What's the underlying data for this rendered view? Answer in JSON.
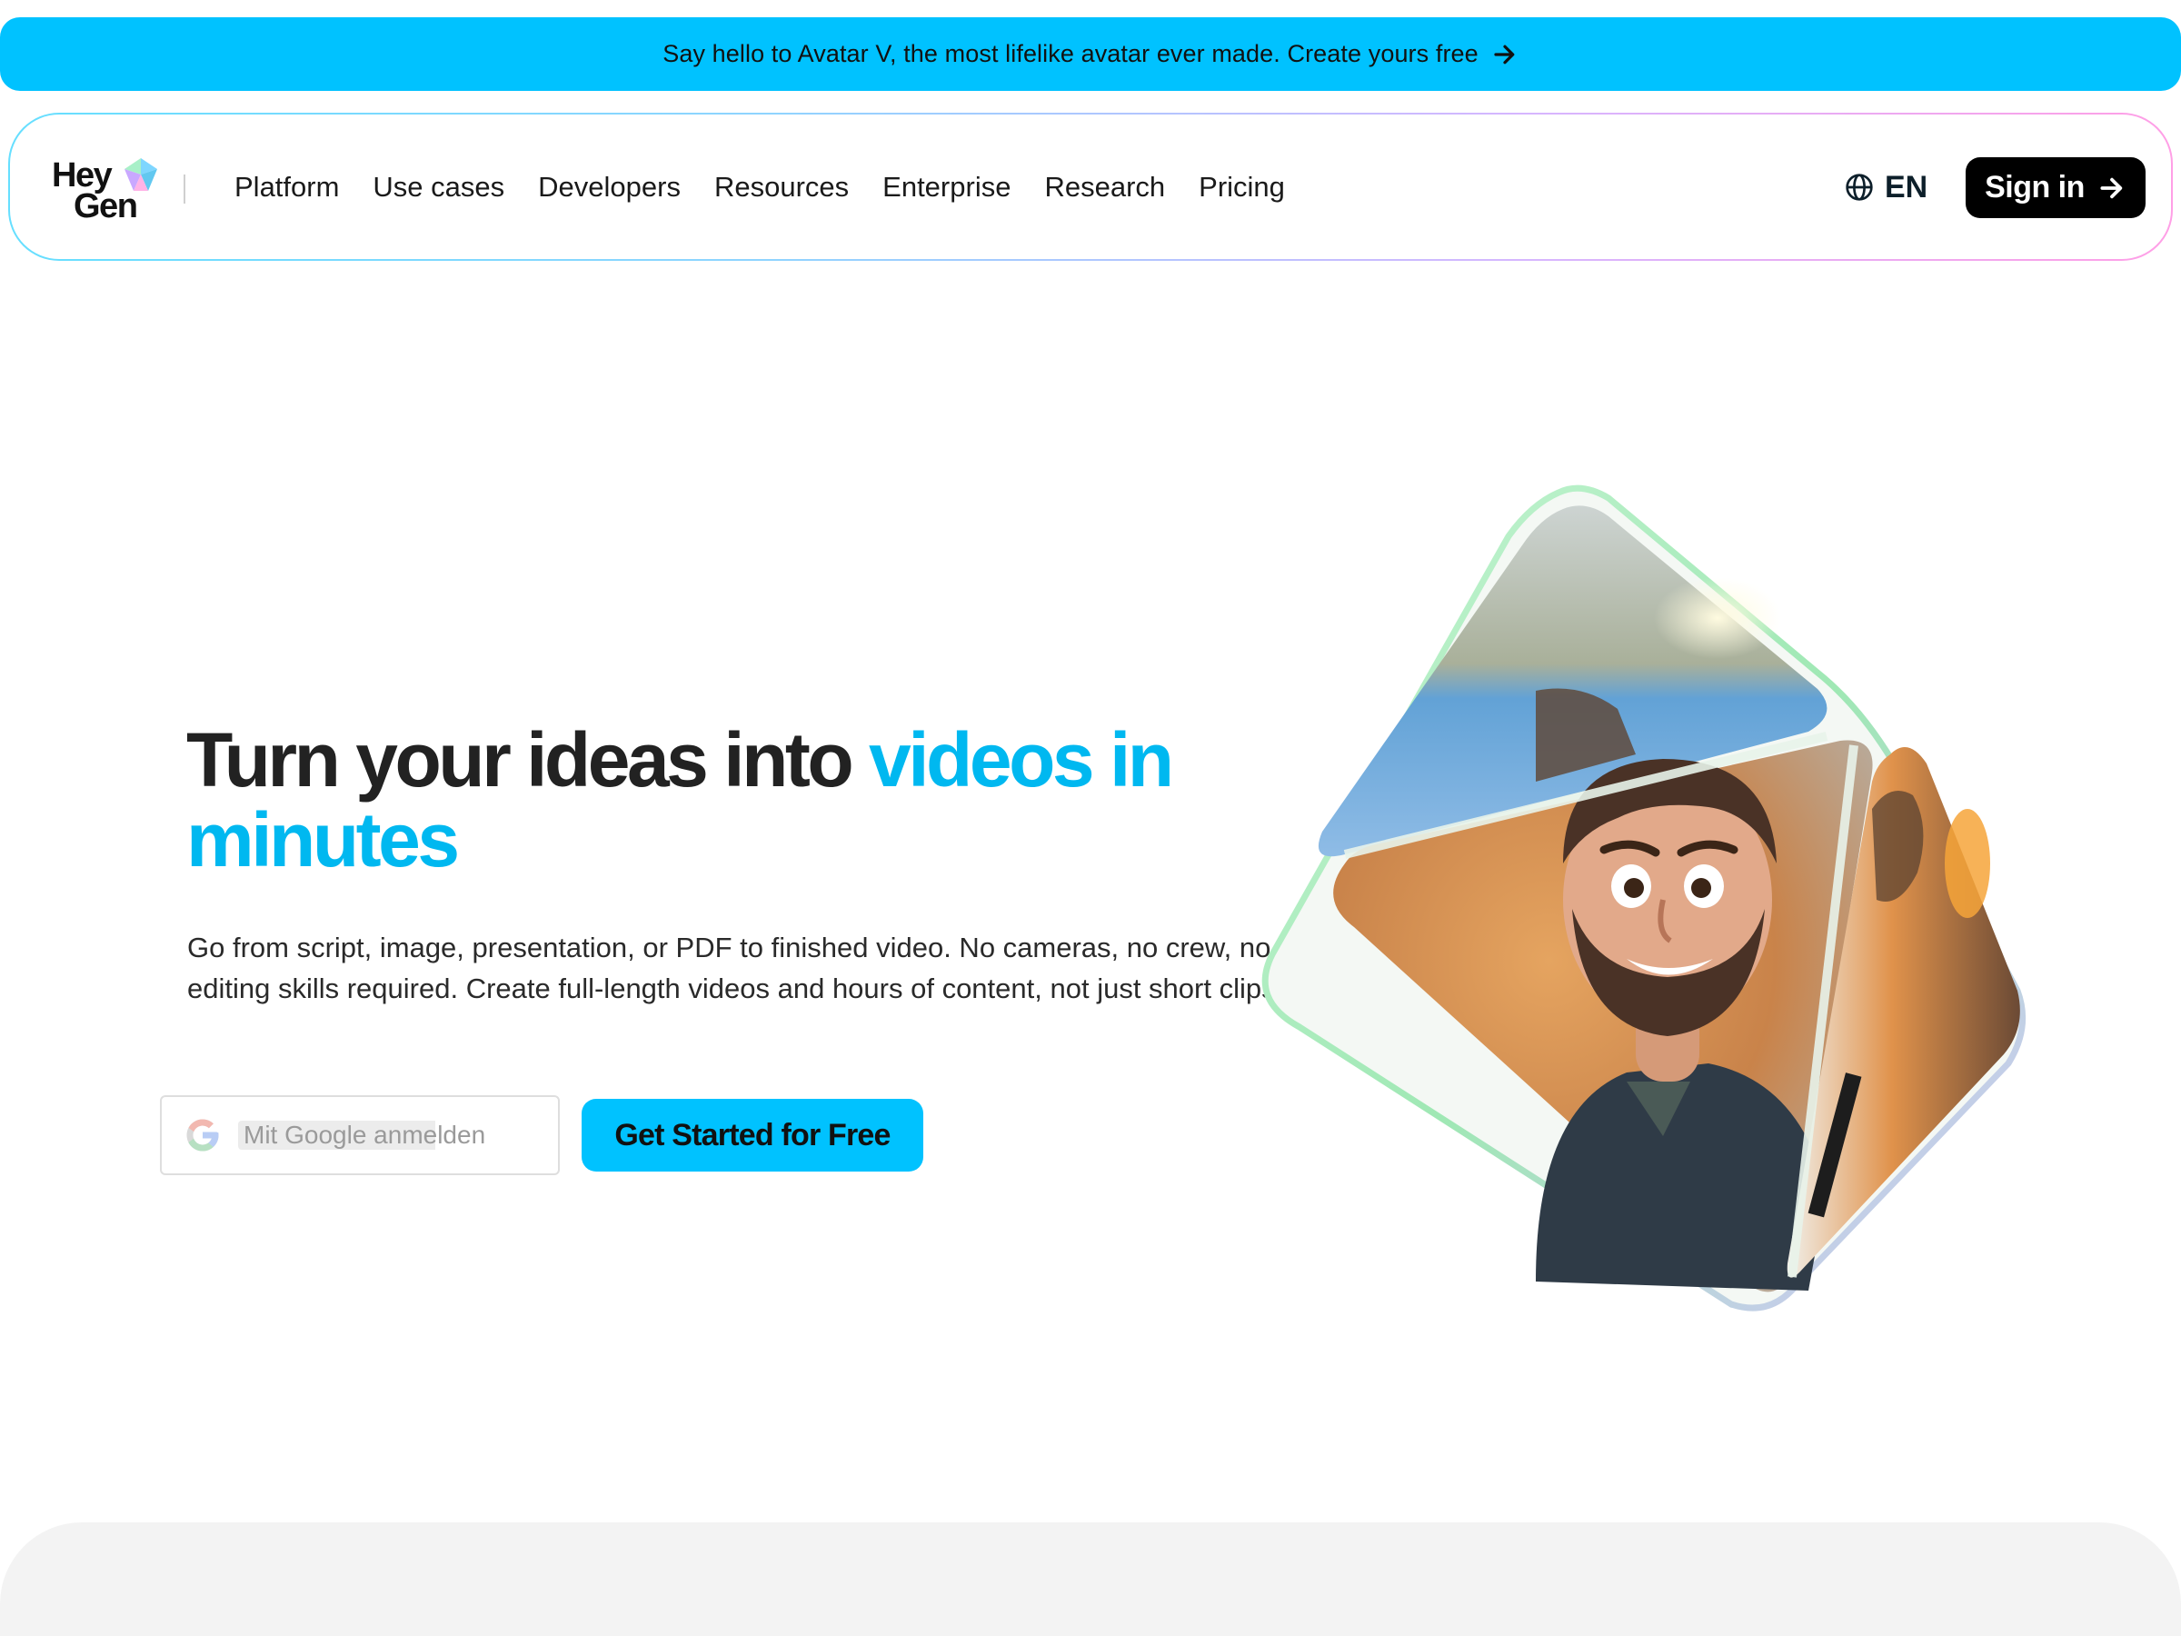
{
  "announcement": {
    "text": "Say hello to Avatar V, the most lifelike avatar ever made. Create yours free",
    "arrow_icon": "arrow-right-icon"
  },
  "nav": {
    "logo": {
      "line1": "Hey",
      "line2": "Gen"
    },
    "links": [
      "Platform",
      "Use cases",
      "Developers",
      "Resources",
      "Enterprise",
      "Research",
      "Pricing"
    ],
    "language": {
      "icon": "globe-icon",
      "label": "EN"
    },
    "signin": {
      "label": "Sign in",
      "icon": "arrow-right-icon"
    }
  },
  "hero": {
    "title_main": "Turn your ideas into ",
    "title_accent": "videos in minutes",
    "subtitle": "Go from script, image, presentation, or PDF to finished video. No cameras, no crew, no editing skills required. Create full-length videos and hours of content, not just short clips.",
    "google_button": {
      "icon": "google-icon",
      "label": "Mit Google anmelden"
    },
    "cta_label": "Get Started for Free"
  },
  "colors": {
    "accent": "#00c2ff",
    "accent_text": "#00b8f0",
    "dark": "#000000",
    "section_bg": "#f3f3f3"
  }
}
